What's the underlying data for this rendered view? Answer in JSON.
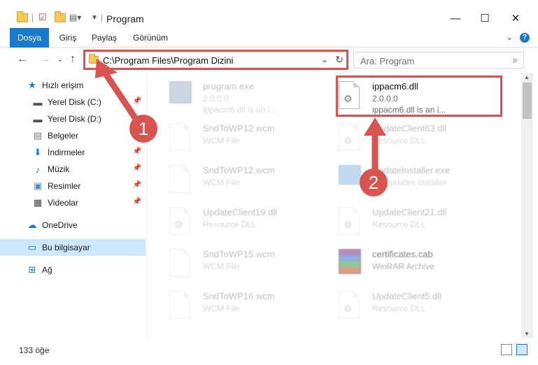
{
  "window": {
    "title": "Program",
    "controls": {
      "minimize": "—",
      "maximize": "☐",
      "close": "✕"
    }
  },
  "ribbon": {
    "tabs": [
      "Dosya",
      "Giriş",
      "Paylaş",
      "Görünüm"
    ],
    "help": "?"
  },
  "nav": {
    "address": "C:\\Program Files\\Program Dizini",
    "search_placeholder": "Ara: Program"
  },
  "sidebar": {
    "items": [
      {
        "label": "Hızlı erişim",
        "icon": "star-icon"
      },
      {
        "label": "Yerel Disk (C:)",
        "icon": "drive-icon",
        "pinned": true
      },
      {
        "label": "Yerel Disk (D:)",
        "icon": "drive-icon"
      },
      {
        "label": "Belgeler",
        "icon": "documents-icon",
        "pinned": true
      },
      {
        "label": "İndirmeler",
        "icon": "download-icon",
        "pinned": true
      },
      {
        "label": "Müzik",
        "icon": "music-icon",
        "pinned": true
      },
      {
        "label": "Resimler",
        "icon": "pictures-icon",
        "pinned": true
      },
      {
        "label": "Videolar",
        "icon": "videos-icon",
        "pinned": true
      },
      {
        "label": "OneDrive",
        "icon": "cloud-icon"
      },
      {
        "label": "Bu bilgisayar",
        "icon": "computer-icon",
        "selected": true
      },
      {
        "label": "Ağ",
        "icon": "network-icon"
      }
    ]
  },
  "files": [
    {
      "name": "program.exe",
      "line2": "2.0.0.0",
      "line3": "ippacm6.dll is an i...",
      "icon": "exe-icon",
      "highlighted": false
    },
    {
      "name": "ippacm6.dll",
      "line2": "2.0.0.0",
      "line3": "ippacm6.dll is an i...",
      "icon": "dll-icon",
      "highlighted": true
    },
    {
      "name": "SndToWP12.wcm",
      "line2": "WCM File",
      "line3": "",
      "icon": "file-icon"
    },
    {
      "name": "UpdateClient63.dll",
      "line2": "Resource DLL",
      "line3": "",
      "icon": "dll-icon"
    },
    {
      "name": "SndToWP12.wcm",
      "line2": "WCM File",
      "line3": "",
      "icon": "file-icon"
    },
    {
      "name": "UpdateInstaller.exe",
      "line2": "BY updates installer",
      "line3": "",
      "icon": "installer-icon"
    },
    {
      "name": "UpdateClient19.dll",
      "line2": "Resource DLL",
      "line3": "",
      "icon": "dll-icon"
    },
    {
      "name": "UpdateClient21.dll",
      "line2": "Resource DLL",
      "line3": "",
      "icon": "dll-icon"
    },
    {
      "name": "SndToWP15.wcm",
      "line2": "WCM File",
      "line3": "",
      "icon": "file-icon"
    },
    {
      "name": "certificates.cab",
      "line2": "WinRAR Archive",
      "line3": "",
      "icon": "archive-icon"
    },
    {
      "name": "SndToWP16.wcm",
      "line2": "WCM File",
      "line3": "",
      "icon": "file-icon"
    },
    {
      "name": "UpdateClient5.dll",
      "line2": "Resource DLL",
      "line3": "",
      "icon": "dll-icon"
    }
  ],
  "status": {
    "count": "133 öğe"
  },
  "annotations": {
    "step1": "1",
    "step2": "2",
    "color": "#d9534f"
  }
}
